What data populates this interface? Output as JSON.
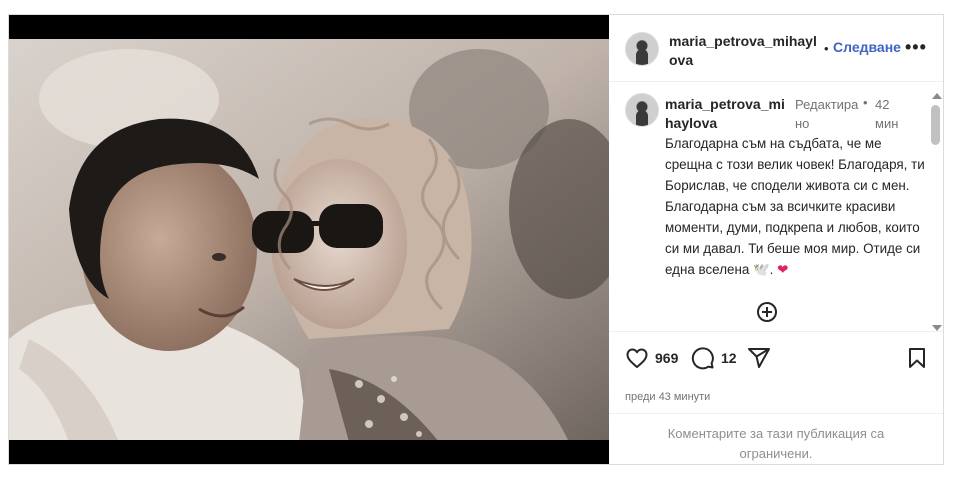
{
  "header": {
    "username": "maria_petrova_mihaylova",
    "dot": "•",
    "follow_label": "Следване",
    "more": "•••"
  },
  "caption": {
    "username": "maria_petrova_mihaylova",
    "edited": "Редактирано",
    "dot": "•",
    "time": "42 мин",
    "text": "Благодарна съм на съдбата, че ме срещна с този велик човек! Благодаря, ти Борислав, че сподели живота си с мен. Благодарна съм за всичките красиви моменти, думи, подкрепа и любов, които си ми давал. Ти беше моя мир.  Отиде си една вселена 🕊️. ",
    "heart": "❤"
  },
  "actions": {
    "likes": "969",
    "comments": "12",
    "posted": "преди 43 минути"
  },
  "notice": {
    "text": "Коментарите за тази публикация са ограничени."
  },
  "icons": [
    "user-avatar-icon",
    "more-options-icon",
    "add-comment-icon",
    "heart-icon",
    "comment-icon",
    "share-icon",
    "bookmark-icon"
  ]
}
